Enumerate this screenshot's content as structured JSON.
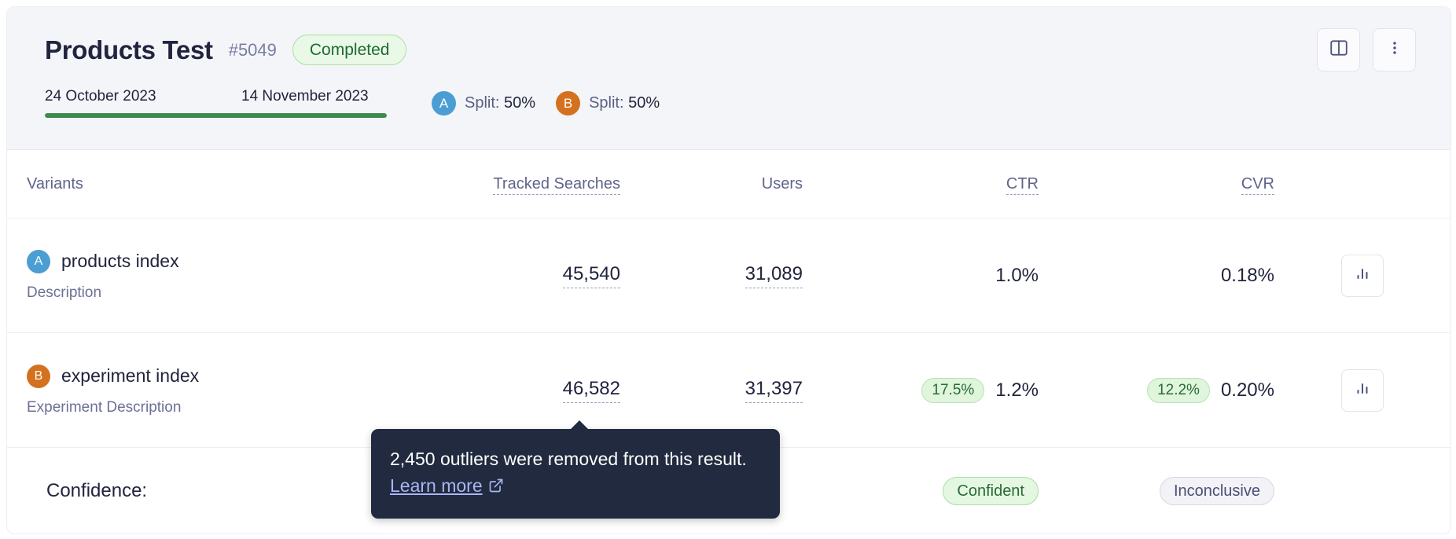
{
  "header": {
    "title": "Products Test",
    "id": "#5049",
    "status": "Completed",
    "date_start": "24 October 2023",
    "date_end": "14 November 2023",
    "progress_percent": 100,
    "splits": [
      {
        "variant": "A",
        "label": "Split: ",
        "value": "50%",
        "color": "#4a9ed3"
      },
      {
        "variant": "B",
        "label": "Split: ",
        "value": "50%",
        "color": "#d4711e"
      }
    ],
    "actions": [
      {
        "name": "split-view-button",
        "icon": "columns-icon"
      },
      {
        "name": "more-options-button",
        "icon": "kebab-menu-icon"
      }
    ]
  },
  "table": {
    "columns": {
      "variants": "Variants",
      "tracked_searches": "Tracked Searches",
      "users": "Users",
      "ctr": "CTR",
      "cvr": "CVR"
    },
    "rows": [
      {
        "variant": "A",
        "name": "products index",
        "description": "Description",
        "tracked_searches": "45,540",
        "users": "31,089",
        "ctr": "1.0%",
        "ctr_uplift": "",
        "cvr": "0.18%",
        "cvr_uplift": "",
        "chart_button": "bar-chart-icon"
      },
      {
        "variant": "B",
        "name": "experiment index",
        "description": "Experiment Description",
        "tracked_searches": "46,582",
        "users": "31,397",
        "ctr": "1.2%",
        "ctr_uplift": "17.5%",
        "cvr": "0.20%",
        "cvr_uplift": "12.2%",
        "chart_button": "bar-chart-icon"
      }
    ],
    "confidence": {
      "label": "Confidence:",
      "ctr": "Confident",
      "cvr": "Inconclusive"
    }
  },
  "tooltip": {
    "text": "2,450 outliers were removed from this result. ",
    "link": "Learn more",
    "icon": "external-link-icon"
  },
  "colors": {
    "variant_a": "#4a9ed3",
    "variant_b": "#d4711e",
    "status_green": "#1d6b32",
    "progress_green": "#3d8b4e",
    "tooltip_bg": "#212a3e",
    "link_blue": "#a9b6f5"
  }
}
